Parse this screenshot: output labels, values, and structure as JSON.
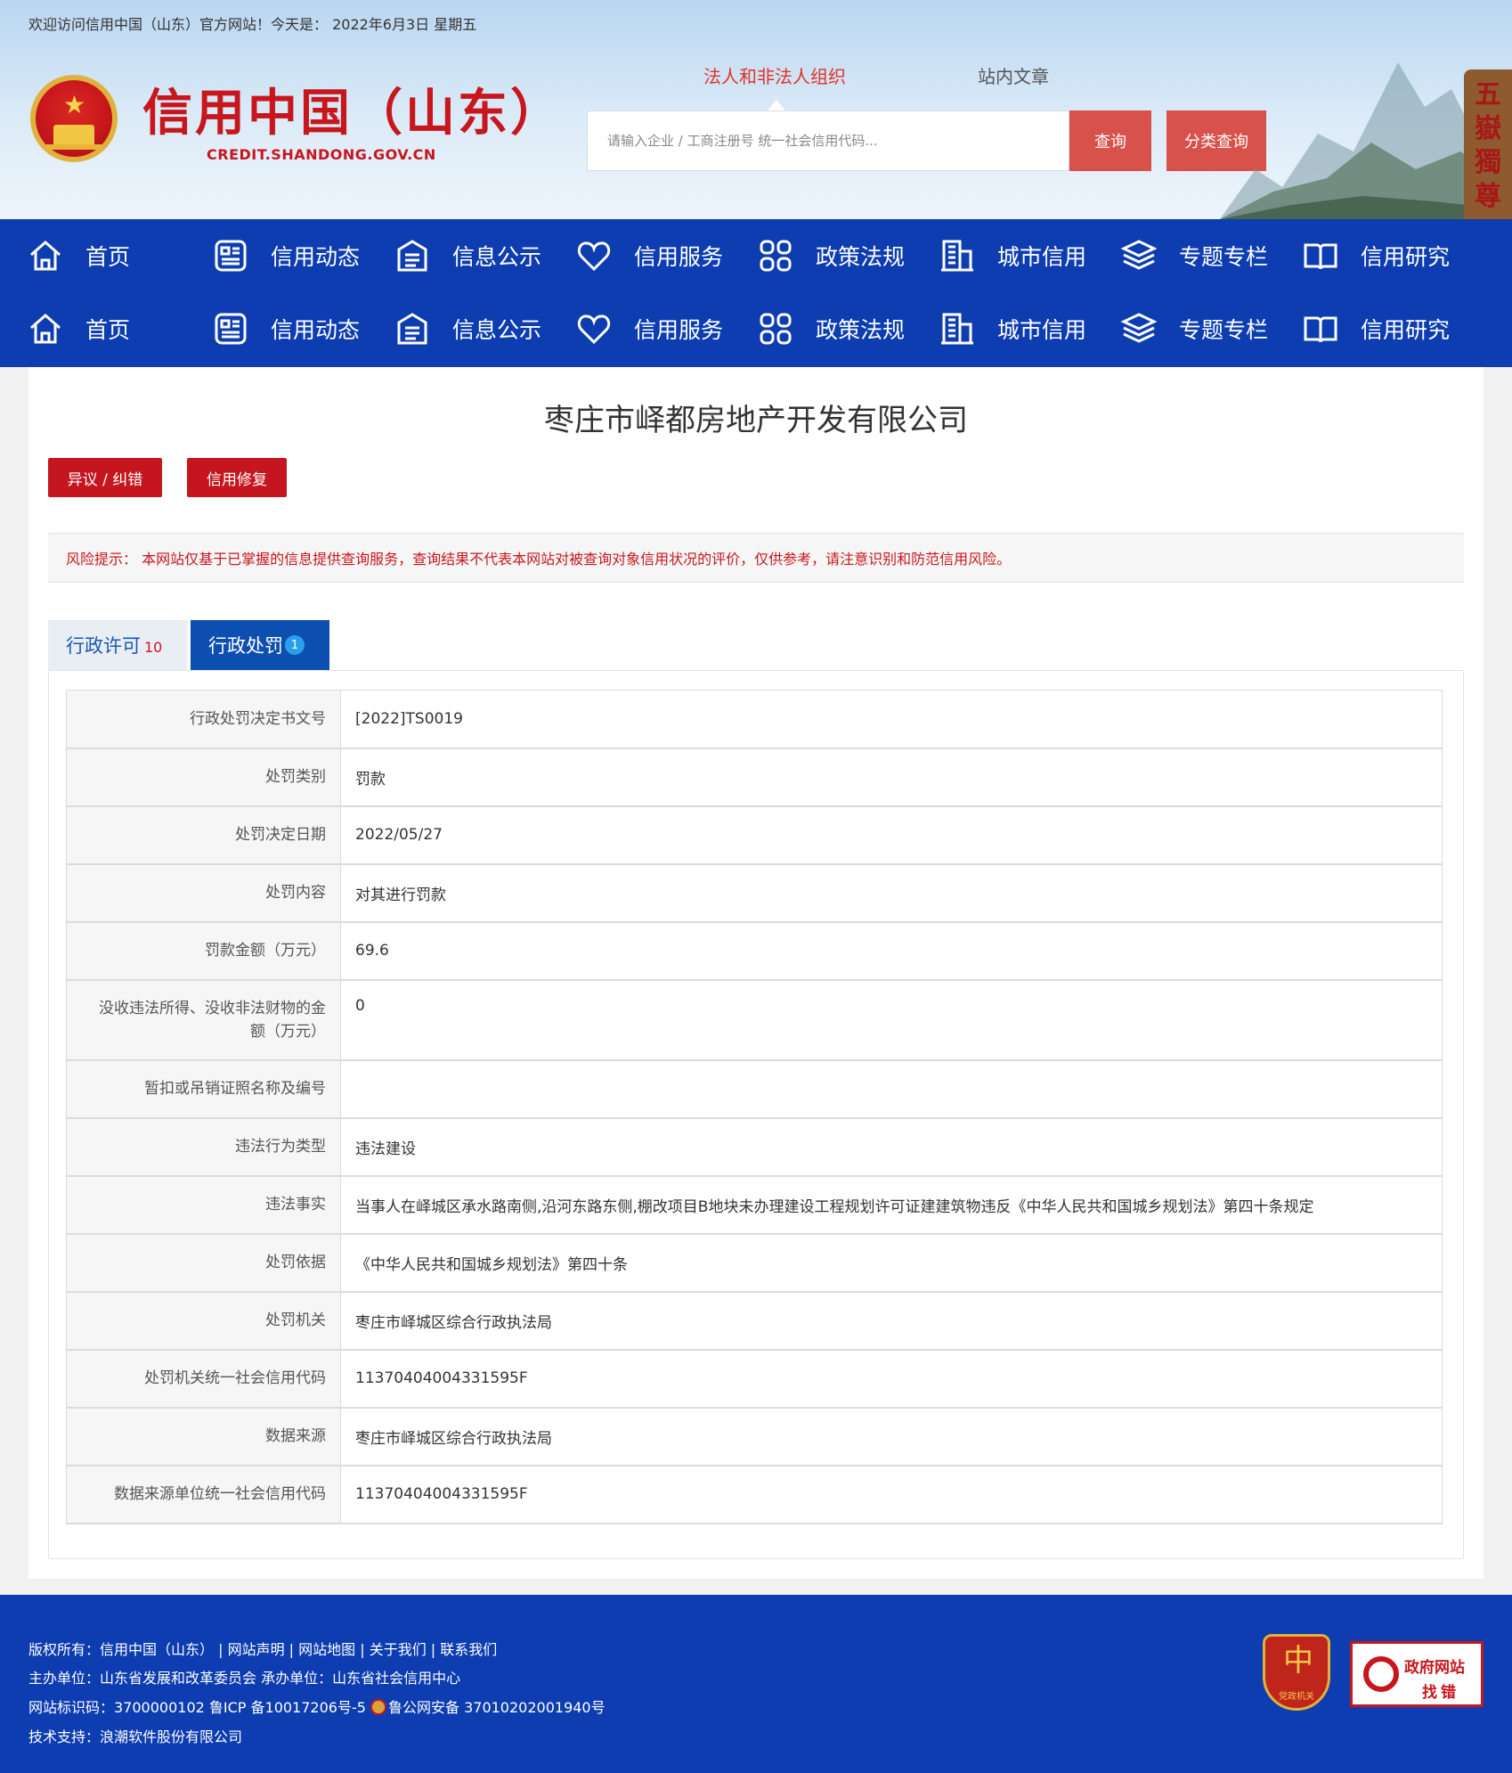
{
  "header": {
    "welcome": "欢迎访问信用中国（山东）官方网站！今天是：  2022年6月3日 星期五",
    "logo_title": "信用中国（山东）",
    "logo_domain": "CREDIT.SHANDONG.GOV.CN",
    "search_tabs": [
      "法人和非法人组织",
      "站内文章"
    ],
    "search_placeholder": "请输入企业 / 工商注册号 统一社会信用代码...",
    "search_button": "查询",
    "category_button": "分类查询",
    "plaque_text": "五嶽獨尊"
  },
  "nav": {
    "items": [
      {
        "label": "首页",
        "icon": "home-icon"
      },
      {
        "label": "信用动态",
        "icon": "news-icon"
      },
      {
        "label": "信息公示",
        "icon": "notice-icon"
      },
      {
        "label": "信用服务",
        "icon": "heart-icon"
      },
      {
        "label": "政策法规",
        "icon": "grid-icon"
      },
      {
        "label": "城市信用",
        "icon": "building-icon"
      },
      {
        "label": "专题专栏",
        "icon": "layers-icon"
      },
      {
        "label": "信用研究",
        "icon": "book-icon"
      }
    ]
  },
  "main": {
    "company_name": "枣庄市峄都房地产开发有限公司",
    "objection_button": "异议 / 纠错",
    "repair_button": "信用修复",
    "risk_notice": "风险提示：  本网站仅基于已掌握的信息提供查询服务，查询结果不代表本网站对被查询对象信用状况的评价，仅供参考，请注意识别和防范信用风险。",
    "tabs": [
      {
        "label": "行政许可",
        "count": "10"
      },
      {
        "label": "行政处罚",
        "count": "1"
      }
    ],
    "record": [
      {
        "key": "行政处罚决定书文号",
        "value": "[2022]TS0019"
      },
      {
        "key": "处罚类别",
        "value": "罚款"
      },
      {
        "key": "处罚决定日期",
        "value": "2022/05/27"
      },
      {
        "key": "处罚内容",
        "value": "对其进行罚款"
      },
      {
        "key": "罚款金额（万元）",
        "value": "69.6"
      },
      {
        "key": "没收违法所得、没收非法财物的金额（万元）",
        "value": "0"
      },
      {
        "key": "暂扣或吊销证照名称及编号",
        "value": ""
      },
      {
        "key": "违法行为类型",
        "value": "违法建设"
      },
      {
        "key": "违法事实",
        "value": "当事人在峄城区承水路南侧,沿河东路东侧,棚改项目B地块未办理建设工程规划许可证建建筑物违反《中华人民共和国城乡规划法》第四十条规定"
      },
      {
        "key": "处罚依据",
        "value": "《中华人民共和国城乡规划法》第四十条"
      },
      {
        "key": "处罚机关",
        "value": "枣庄市峄城区综合行政执法局"
      },
      {
        "key": "处罚机关统一社会信用代码",
        "value": "11370404004331595F"
      },
      {
        "key": "数据来源",
        "value": "枣庄市峄城区综合行政执法局"
      },
      {
        "key": "数据来源单位统一社会信用代码",
        "value": "11370404004331595F"
      }
    ]
  },
  "footer": {
    "line1": "版权所有：信用中国（山东） | 网站声明 | 网站地图 | 关于我们 | 联系我们",
    "line2": "主办单位：山东省发展和改革委员会    承办单位：山东省社会信用中心",
    "line3a": "网站标识码：3700000102    鲁ICP 备10017206号-5",
    "line3b": "鲁公网安备 37010202001940号",
    "line4": "技术支持：浪潮软件股份有限公司",
    "party_badge_label": "党政机关",
    "gov_badge_line1": "政府网站",
    "gov_badge_line2": "找错"
  },
  "colors": {
    "nav_blue": "#0d3db0",
    "brand_red": "#c8161d",
    "button_red": "#d8514a",
    "tab_active_blue": "#0d4fb0"
  }
}
